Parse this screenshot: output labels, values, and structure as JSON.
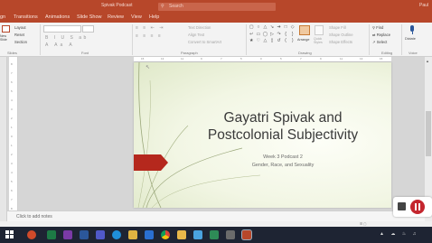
{
  "window": {
    "title": "Spivak Podcast",
    "search_placeholder": "Search",
    "user": "Paul"
  },
  "tabs": [
    "gn",
    "Transitions",
    "Animations",
    "Slide Show",
    "Review",
    "View",
    "Help"
  ],
  "ribbon": {
    "groups": [
      "Slides",
      "Font",
      "Paragraph",
      "Drawing",
      "Editing",
      "Voice"
    ],
    "slides": {
      "new_slide": "New\nSlide",
      "layout": "Layout",
      "reset": "Reset",
      "section": "Section"
    },
    "paragraph": {
      "text_direction": "Text Direction",
      "align_text": "Align Text",
      "convert_smartart": "Convert to SmartArt"
    },
    "drawing": {
      "arrange": "Arrange",
      "quick_styles": "Quick\nStyles",
      "shape_fill": "Shape Fill",
      "shape_outline": "Shape Outline",
      "shape_effects": "Shape Effects"
    },
    "editing": {
      "find": "Find",
      "replace": "Replace",
      "select": "Select"
    },
    "voice": {
      "dictate": "Dictate"
    }
  },
  "slide": {
    "title": "Gayatri Spivak and Postcolonial Subjectivity",
    "subtitle_line1": "Week 3 Podcast 2",
    "subtitle_line2": "Gender, Race, and Sexuality"
  },
  "notes": {
    "placeholder": "Click to add notes"
  },
  "colors": {
    "accent": "#b7472a",
    "slide_arrow": "#b5281d",
    "taskbar": "#1e2433"
  },
  "taskbar_icons": [
    "windows-icon",
    "search-icon",
    "chrome-icon",
    "excel-icon",
    "onenote-icon",
    "word-icon",
    "teams-icon",
    "edge-icon",
    "explorer-icon",
    "mail-icon",
    "chrome2-icon",
    "folder-icon",
    "store-icon",
    "lock-icon",
    "powerpoint-icon"
  ]
}
